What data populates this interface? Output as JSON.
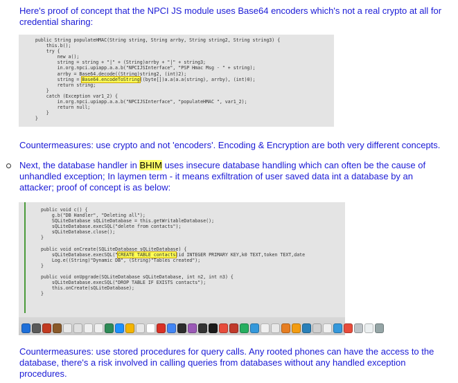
{
  "intro": "Here's proof of concept that the NPCI JS module uses Base64 encoders which's not a real crypto at all for credential sharing:",
  "code1_lines": [
    "    public String populateHMAC(String string, String arrby, String string2, String string3) {",
    "        this.b();",
    "        try {",
    "            new a();",
    "            string = string + \"|\" + (String)arrby + \"|\" + string3;",
    "            in.org.npci.upiapp.a.a.b(\"NPCIJSInterface\", \"PSP Hmac Msg - \" + string);",
    "            arrby = Base64.decode((String)string2, (int)2);",
    "            string = Base64.encodeToString((byte[])a.a(a.a(string), arrby), (int)0);",
    "            return string;",
    "        }",
    "        catch (Exception var1_2) {",
    "            in.org.npci.upiapp.a.a.b(\"NPCIJSInterface\", \"populateHMAC \", var1_2);",
    "            return null;",
    "        }",
    "    }"
  ],
  "countermeasure1": "Countermeasures: use crypto and not 'encoders'. Encoding & Encryption are both very different concepts.",
  "bullet_before": "Next, the database handler in ",
  "bullet_highlight": "BHIM",
  "bullet_after": " uses insecure database handling which can often be the cause of unhandled exception; In laymen term - it means exfiltration of user saved data int a database by an attacker; proof of concept is as below:",
  "code2_lines": [
    "public void c() {",
    "    g.b(\"DB Handler\", \"Deleting all\");",
    "    SQLiteDatabase sQLiteDatabase = this.getWritableDatabase();",
    "    sQLiteDatabase.execSQL(\"delete from contacts\");",
    "    sQLiteDatabase.close();",
    "}",
    "",
    "public void onCreate(SQLiteDatabase sQLiteDatabase) {",
    "    sQLiteDatabase.execSQL(\"CREATE TABLE contacts(id INTEGER PRIMARY KEY,k0 TEXT,token TEXT,date",
    "    Log.e((String)\"Dynamic DB\", (String)\"Tables created\");",
    "}",
    "",
    "public void onUpgrade(SQLiteDatabase sQLiteDatabase, int n2, int n3) {",
    "    sQLiteDatabase.execSQL(\"DROP TABLE IF EXISTS contacts\");",
    "    this.onCreate(sQLiteDatabase);",
    "}"
  ],
  "countermeasure2": "Countermeasures: use stored procedures for query calls. Any rooted phones can have the access to the database, there's a risk involved in calling queries from databases without any handled exception procedures.",
  "dock_icon_colors": [
    "#1e6fd9",
    "#5a5a5a",
    "#c23b22",
    "#8a5a2a",
    "#e8e8e8",
    "#e0e0e0",
    "#f0f0f0",
    "#f0f0f0",
    "#2e8b57",
    "#1e90ff",
    "#f4b400",
    "#e8e8e8",
    "#ffffff",
    "#d93025",
    "#4285f4",
    "#2c2c2c",
    "#9b59b6",
    "#333333",
    "#1a1a1a",
    "#e74c3c",
    "#c0392b",
    "#27ae60",
    "#3498db",
    "#f0f0f0",
    "#e8e8e8",
    "#e67e22",
    "#f39c12",
    "#2980b9",
    "#d0d0d0",
    "#f0f0f0",
    "#3498db",
    "#e74c3c",
    "#bdc3c7",
    "#ecf0f1",
    "#95a5a6"
  ]
}
